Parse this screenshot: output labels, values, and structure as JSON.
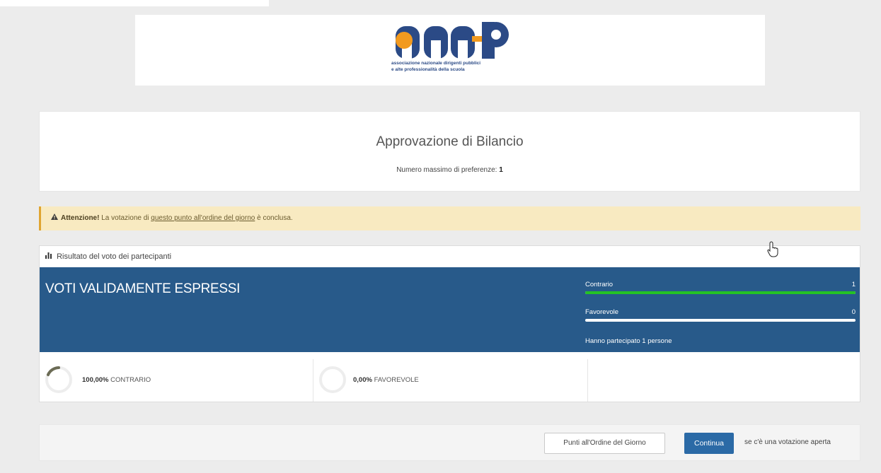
{
  "logo": {
    "text": "ANP",
    "line1": "associazione nazionale dirigenti pubblici",
    "line2": "e alte professionalità della scuola"
  },
  "ballot": {
    "title": "Approvazione di Bilancio",
    "max_label": "Numero massimo di preferenze:",
    "max_value": "1"
  },
  "alert": {
    "icon": "warning-icon",
    "strong": "Attenzione!",
    "pre": "La votazione di",
    "link": "questo punto all'ordine del giorno",
    "post": "è conclusa.",
    "color": "#f8eac1"
  },
  "results": {
    "header_icon": "bar-chart-icon",
    "header": "Risultato del voto dei partecipanti",
    "panel_title": "VOTI VALIDAMENTE ESPRESSI",
    "panel_color": "#285a8a",
    "options": [
      {
        "label": "Contrario",
        "value": "1",
        "fraction": 1.0,
        "color": "#24c224"
      },
      {
        "label": "Favorevole",
        "value": "0",
        "fraction": 0.0,
        "color": "#24c224"
      }
    ],
    "participants": "Hanno partecipato 1 persone",
    "stats": [
      {
        "percent": "100,00%",
        "label": "CONTRARIO",
        "fraction": 1.0
      },
      {
        "percent": "0,00%",
        "label": "FAVOREVOLE",
        "fraction": 0.0
      }
    ]
  },
  "footer": {
    "punti_button": "Punti all'Ordine del Giorno",
    "continua_button": "Continua",
    "note": "se c'è una votazione aperta",
    "accent": "#2b6aa6"
  }
}
